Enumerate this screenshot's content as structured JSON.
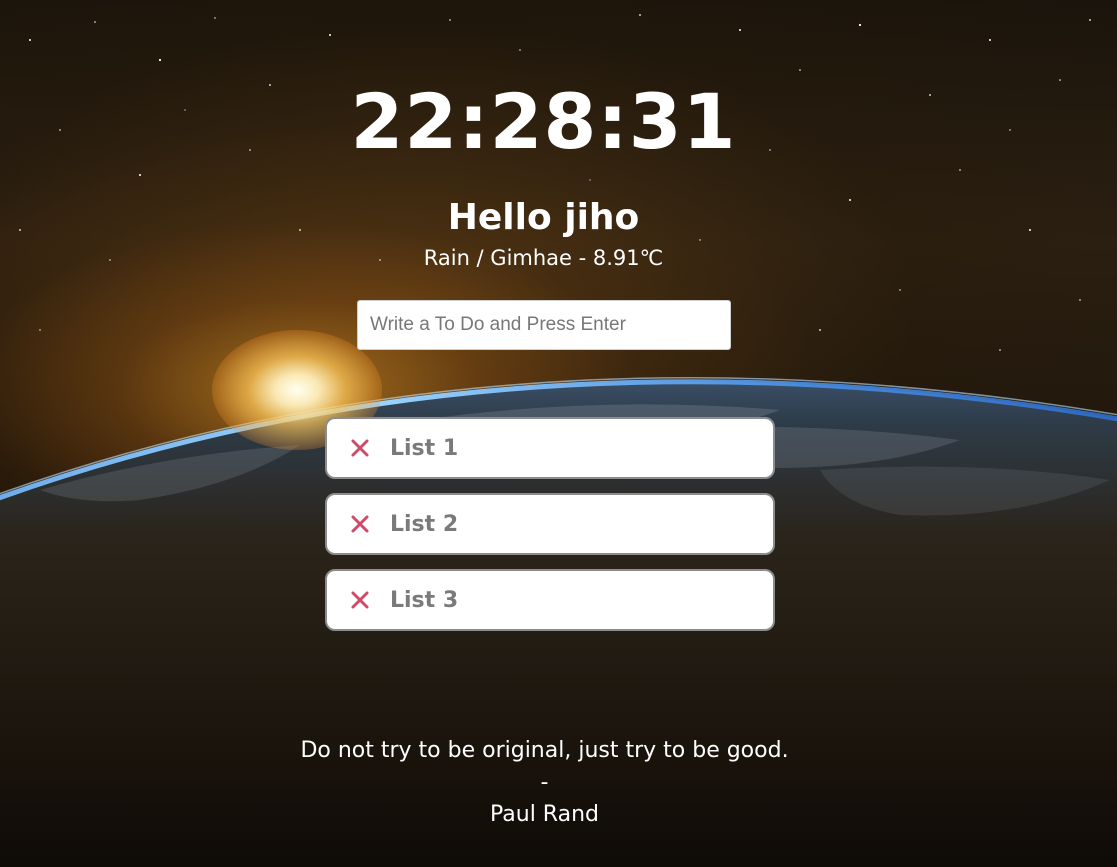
{
  "clock": {
    "time": "22:28:31"
  },
  "greeting": {
    "text": "Hello jiho"
  },
  "weather": {
    "text": "Rain / Gimhae - 8.91℃"
  },
  "todo_input": {
    "placeholder": "Write a To Do and Press Enter",
    "value": ""
  },
  "todos": [
    {
      "label": "List 1",
      "delete_icon": "close-icon"
    },
    {
      "label": "List 2",
      "delete_icon": "close-icon"
    },
    {
      "label": "List 3",
      "delete_icon": "close-icon"
    }
  ],
  "quote": {
    "text": "Do not try to be original, just try to be good.",
    "separator": "-",
    "author": "Paul Rand"
  },
  "colors": {
    "delete_icon": "#d04a6a",
    "item_text": "#7a7a7a",
    "item_border": "#8c8c8c",
    "foreground_text": "#ffffff"
  }
}
